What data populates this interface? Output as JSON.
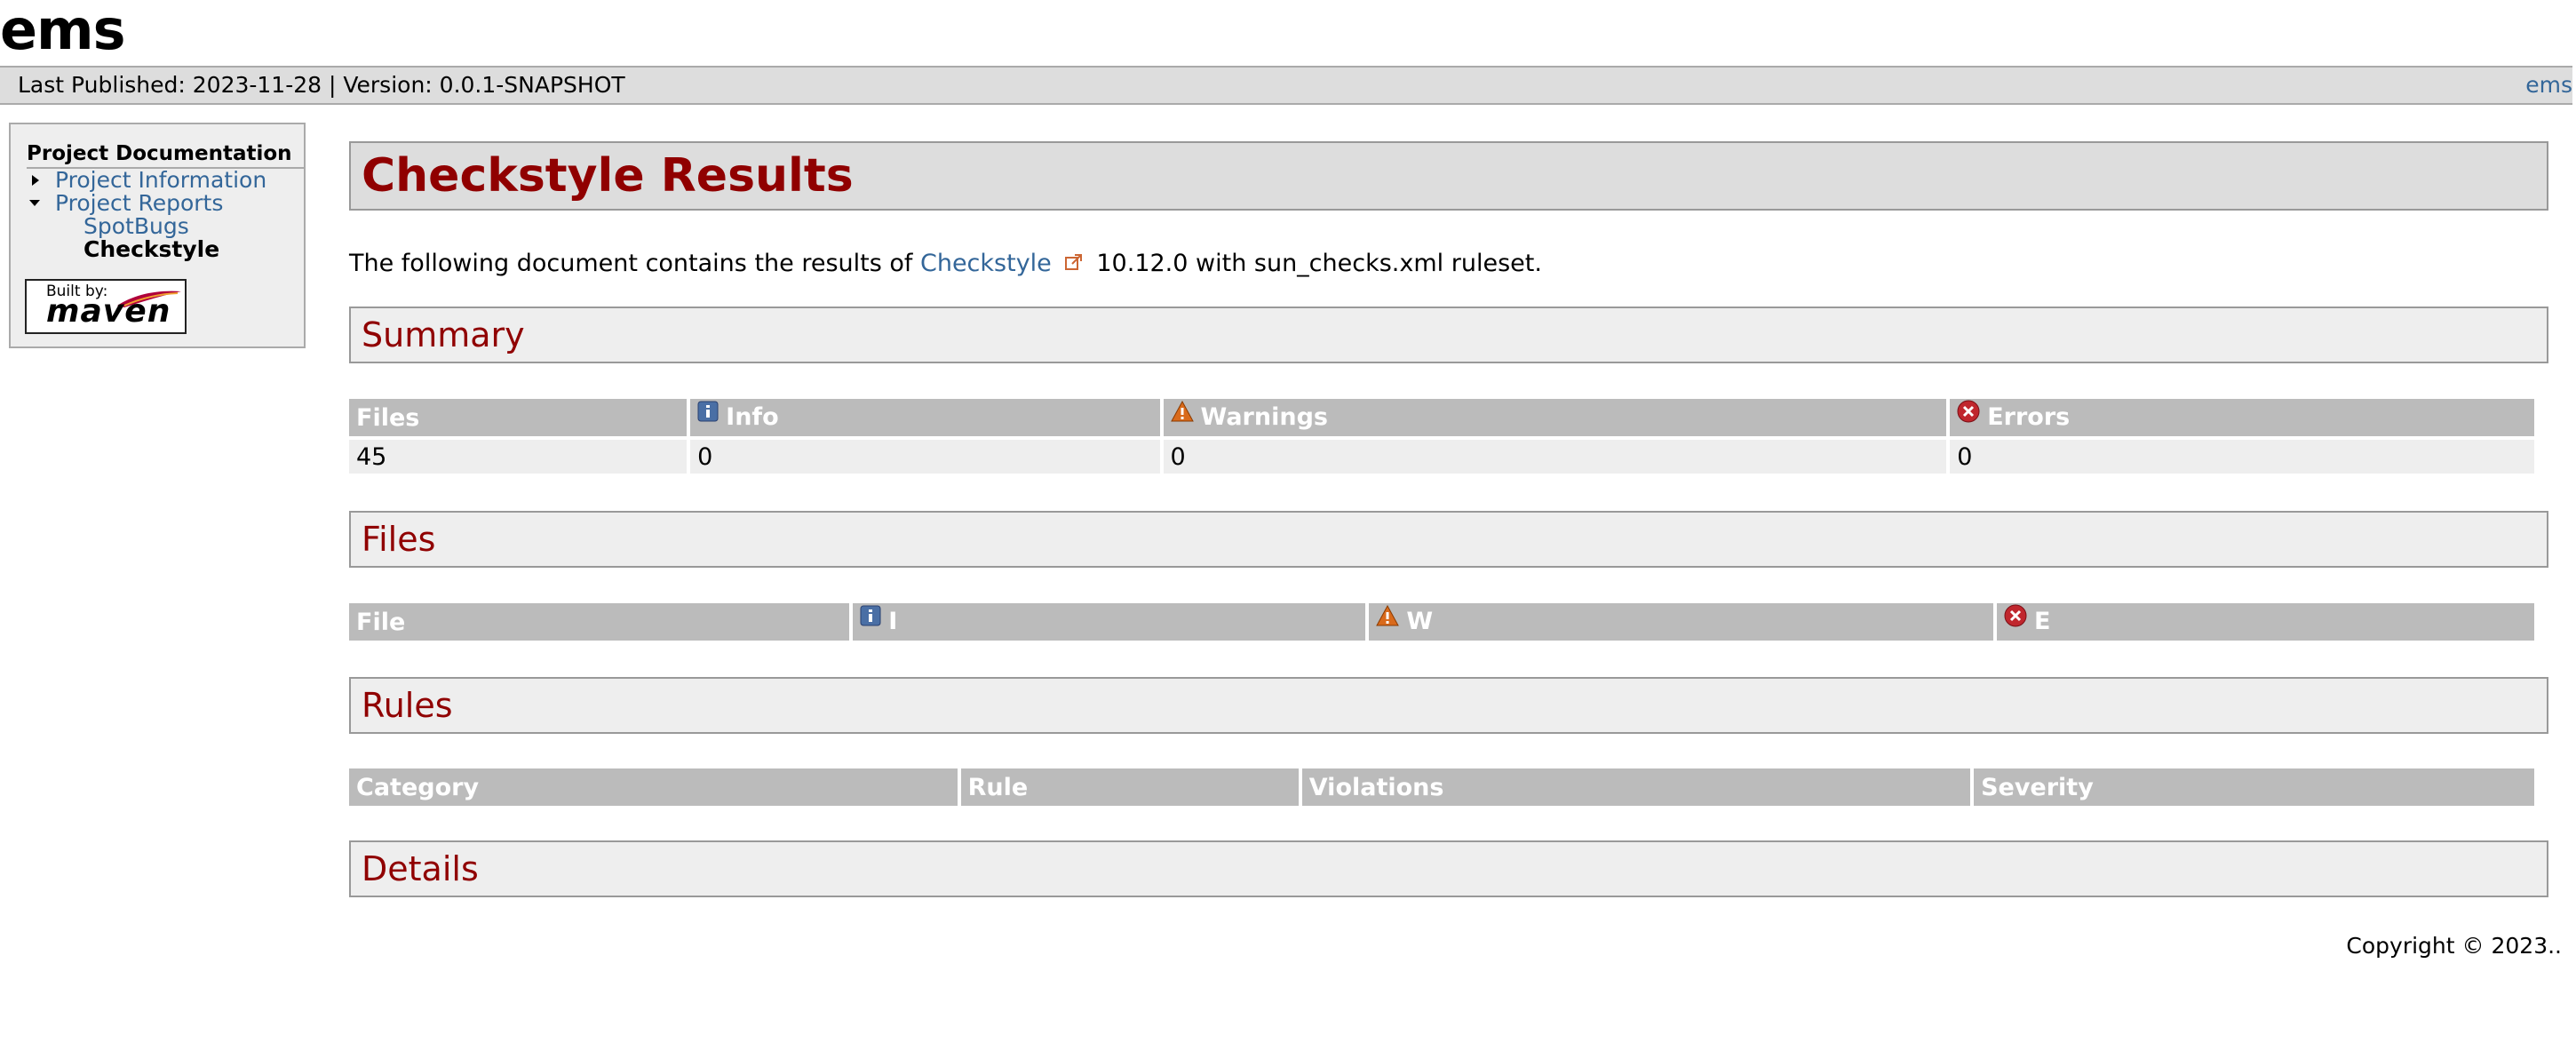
{
  "banner": {
    "title": "ems"
  },
  "breadcrumbs": {
    "left": "Last Published: 2023-11-28 | Version: 0.0.1-SNAPSHOT",
    "right_link": "ems"
  },
  "nav": {
    "heading": "Project Documentation",
    "items": [
      {
        "label": "Project Information"
      },
      {
        "label": "Project Reports"
      },
      {
        "label": "SpotBugs"
      },
      {
        "label": "Checkstyle"
      }
    ],
    "badge": {
      "built_by": "Built by:",
      "maven": "maven"
    }
  },
  "main": {
    "title": "Checkstyle Results",
    "intro_before": "The following document contains the results of ",
    "intro_link": "Checkstyle",
    "intro_after": " 10.12.0 with sun_checks.xml ruleset.",
    "summary": {
      "heading": "Summary",
      "headers": [
        "Files",
        "Info",
        "Warnings",
        "Errors"
      ],
      "row": [
        "45",
        "0",
        "0",
        "0"
      ]
    },
    "files": {
      "heading": "Files",
      "headers": [
        "File",
        "I",
        "W",
        "E"
      ]
    },
    "rules": {
      "heading": "Rules",
      "headers": [
        "Category",
        "Rule",
        "Violations",
        "Severity"
      ]
    },
    "details": {
      "heading": "Details"
    }
  },
  "footer": {
    "copyright": "Copyright © 2023.."
  },
  "colors": {
    "heading_red": "#900000",
    "link_blue": "#336699",
    "header_gray": "#bbbbbb",
    "row_gray": "#eeeeee"
  },
  "icons": {
    "info": "info-icon",
    "warning": "warning-icon",
    "error": "error-icon",
    "external": "external-link-icon"
  }
}
